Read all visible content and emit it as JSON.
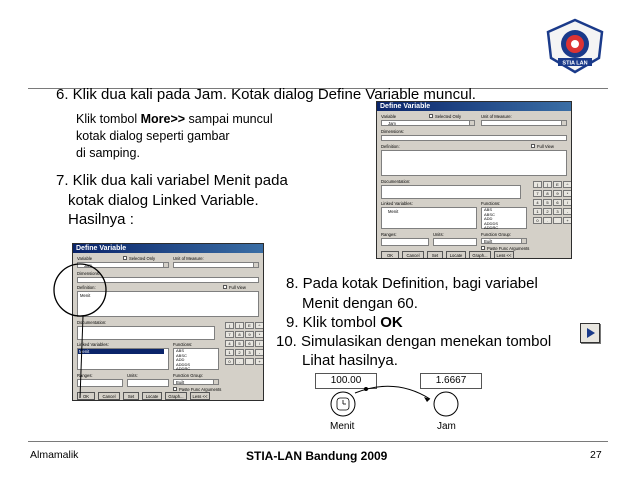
{
  "logo": {
    "text": "STIA LAN"
  },
  "steps": {
    "s6": "6. Klik dua kali pada Jam. Kotak dialog Define Variable muncul.",
    "sub_a": "Klik tombol ",
    "sub_b": "More>>",
    "sub_c": " sampai muncul",
    "sub_d": "kotak dialog seperti gambar",
    "sub_e": "di samping.",
    "s7a": "7. Klik dua kali variabel Menit pada",
    "s7b": "kotak dialog Linked Variable.",
    "s7c": "Hasilnya :",
    "s8a": "8. Pada kotak Definition, bagi variabel",
    "s8b": "Menit dengan 60.",
    "s9a": "9. Klik tombol ",
    "s9b": "OK",
    "s10a": "10. Simulasikan dengan menekan tombol",
    "s10b": "Lihat hasilnya."
  },
  "dialog": {
    "title": "Define Variable",
    "variable_label": "Variable",
    "variable_value": "Jam",
    "selected_only": "Selected Only",
    "unit_label": "Unit of Measure:",
    "dimensions": "Dimensions:",
    "definition": "Definition:",
    "definition_value": "Menit",
    "full_view": "Full View",
    "documentation": "Documentation:",
    "linked_label": "Linked Variables:",
    "linked_item": "Menit",
    "functions_label": "Functions:",
    "functions_list": [
      "ABS",
      "ABSC",
      "ADD",
      "ADDDS",
      "ADDRC"
    ],
    "ranges": "Ranges:",
    "units": "Units:",
    "function_group": "Function Group:",
    "function_group_value": "Built",
    "paste_func": "Paste Func Arguments",
    "buttons": [
      "OK",
      "Cancel",
      "Set",
      "Locate",
      "Graph...",
      "Less <<"
    ],
    "keypad": [
      "(",
      ")",
      "E",
      "^",
      "7",
      "8",
      "9",
      "*",
      "4",
      "5",
      "6",
      "/",
      "1",
      "2",
      "3",
      "-",
      "0",
      ".",
      "",
      "+"
    ]
  },
  "sim": {
    "value_left": "100.00",
    "value_right": "1.6667",
    "node_left": "Menit",
    "node_right": "Jam"
  },
  "footer": {
    "left": "Almamalik",
    "center": "STIA-LAN Bandung 2009",
    "right": "27"
  }
}
